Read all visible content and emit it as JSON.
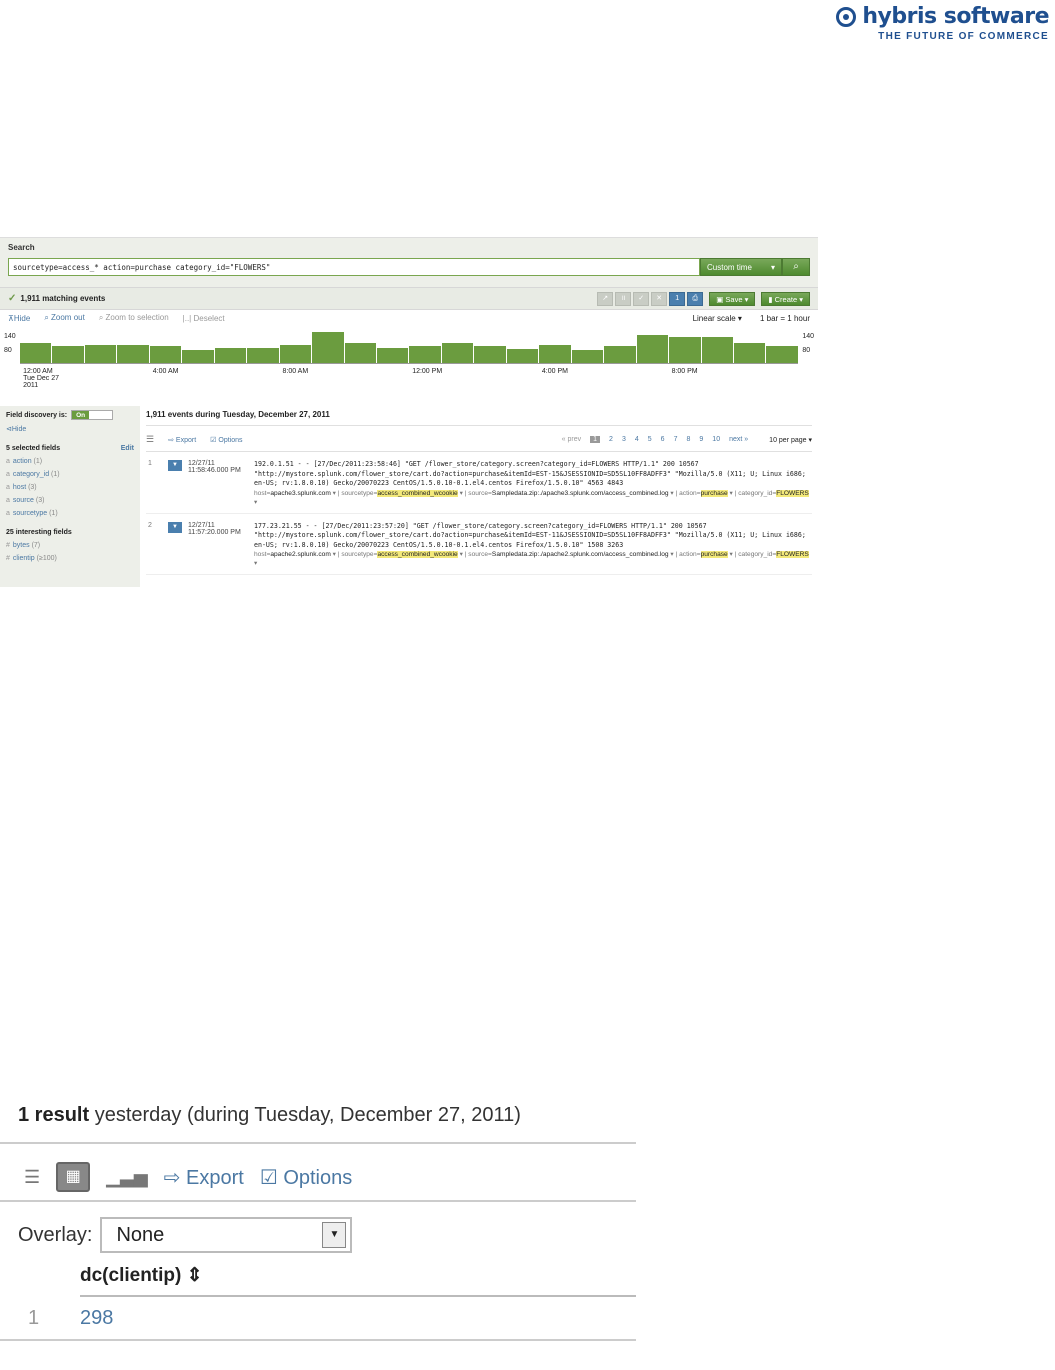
{
  "logo": {
    "name": "hybris software",
    "tagline": "THE FUTURE OF COMMERCE"
  },
  "search": {
    "title": "Search",
    "query": "sourcetype=access_* action=purchase category_id=\"FLOWERS\"",
    "time_label": "Custom time",
    "time_caret": "▾"
  },
  "results_bar": {
    "matching": "1,911 matching events",
    "job_count": "1",
    "save_label": "Save",
    "create_label": "Create"
  },
  "timeline": {
    "hide": "Hide",
    "zoom_out": "Zoom out",
    "zoom_to_selection": "Zoom to selection",
    "deselect": "Deselect",
    "scale": "Linear scale",
    "bar_span": "1 bar = 1 hour",
    "y_top": "140",
    "y_mid": "80",
    "bar_levels": [
      0.55,
      0.45,
      0.5,
      0.5,
      0.45,
      0.35,
      0.4,
      0.4,
      0.5,
      0.85,
      0.55,
      0.4,
      0.45,
      0.55,
      0.45,
      0.38,
      0.5,
      0.35,
      0.45,
      0.75,
      0.7,
      0.7,
      0.55,
      0.45
    ],
    "x_labels": [
      "12:00 AM",
      "4:00 AM",
      "8:00 AM",
      "12:00 PM",
      "4:00 PM",
      "8:00 PM"
    ],
    "x_sub1": "Tue Dec 27",
    "x_sub2": "2011"
  },
  "sidebar": {
    "field_discovery": "Field discovery is:",
    "toggle_on": "On",
    "hide": "Hide",
    "selected_head": "5 selected fields",
    "edit": "Edit",
    "selected": [
      {
        "name": "action",
        "count": "(1)"
      },
      {
        "name": "category_id",
        "count": "(1)"
      },
      {
        "name": "host",
        "count": "(3)"
      },
      {
        "name": "source",
        "count": "(3)"
      },
      {
        "name": "sourcetype",
        "count": "(1)"
      }
    ],
    "interesting_head": "25 interesting fields",
    "interesting": [
      {
        "name": "bytes",
        "count": "(7)"
      },
      {
        "name": "clientip",
        "count": "(≥100)"
      }
    ]
  },
  "events": {
    "title": "1,911 events during Tuesday, December 27, 2011",
    "export": "Export",
    "options": "Options",
    "prev": "« prev",
    "pages": [
      "1",
      "2",
      "3",
      "4",
      "5",
      "6",
      "7",
      "8",
      "9",
      "10"
    ],
    "next": "next »",
    "per_page": "10 per page",
    "list": [
      {
        "num": "1",
        "date": "12/27/11",
        "time": "11:58:46.000 PM",
        "raw": "192.0.1.51 - - [27/Dec/2011:23:58:46] \"GET /flower_store/category.screen?category_id=FLOWERS HTTP/1.1\" 200 10567 \"http://mystore.splunk.com/flower_store/cart.do?action=purchase&itemId=EST-15&JSESSIONID=SD5SL10FF8ADFF3\" \"Mozilla/5.0 (X11; U; Linux i686; en-US; rv:1.8.0.10) Gecko/20070223 CentOS/1.5.0.10-0.1.el4.centos Firefox/1.5.0.10\" 4563 4843",
        "host": "apache3.splunk.com",
        "sourcetype": "access_combined_wcookie",
        "source": "Sampledata.zip:./apache3.splunk.com/access_combined.log",
        "action": "purchase",
        "category_id": "FLOWERS"
      },
      {
        "num": "2",
        "date": "12/27/11",
        "time": "11:57:20.000 PM",
        "raw": "177.23.21.55 - - [27/Dec/2011:23:57:20] \"GET /flower_store/category.screen?category_id=FLOWERS HTTP/1.1\" 200 10567 \"http://mystore.splunk.com/flower_store/cart.do?action=purchase&itemId=EST-11&JSESSIONID=SD5SL10FF8ADFF3\" \"Mozilla/5.0 (X11; U; Linux i686; en-US; rv:1.8.0.10) Gecko/20070223 CentOS/1.5.0.10-0.1.el4.centos Firefox/1.5.0.10\" 1508 3263",
        "host": "apache2.splunk.com",
        "sourcetype": "access_combined_wcookie",
        "source": "Sampledata.zip:./apache2.splunk.com/access_combined.log",
        "action": "purchase",
        "category_id": "FLOWERS"
      }
    ]
  },
  "results2": {
    "count": "1 result",
    "rest": " yesterday (during Tuesday, December 27, 2011)",
    "export": "Export",
    "options": "Options",
    "overlay_label": "Overlay:",
    "overlay_value": "None",
    "column": "dc(clientip)",
    "sort_icon": "⇕",
    "row_index": "1",
    "row_value": "298"
  }
}
